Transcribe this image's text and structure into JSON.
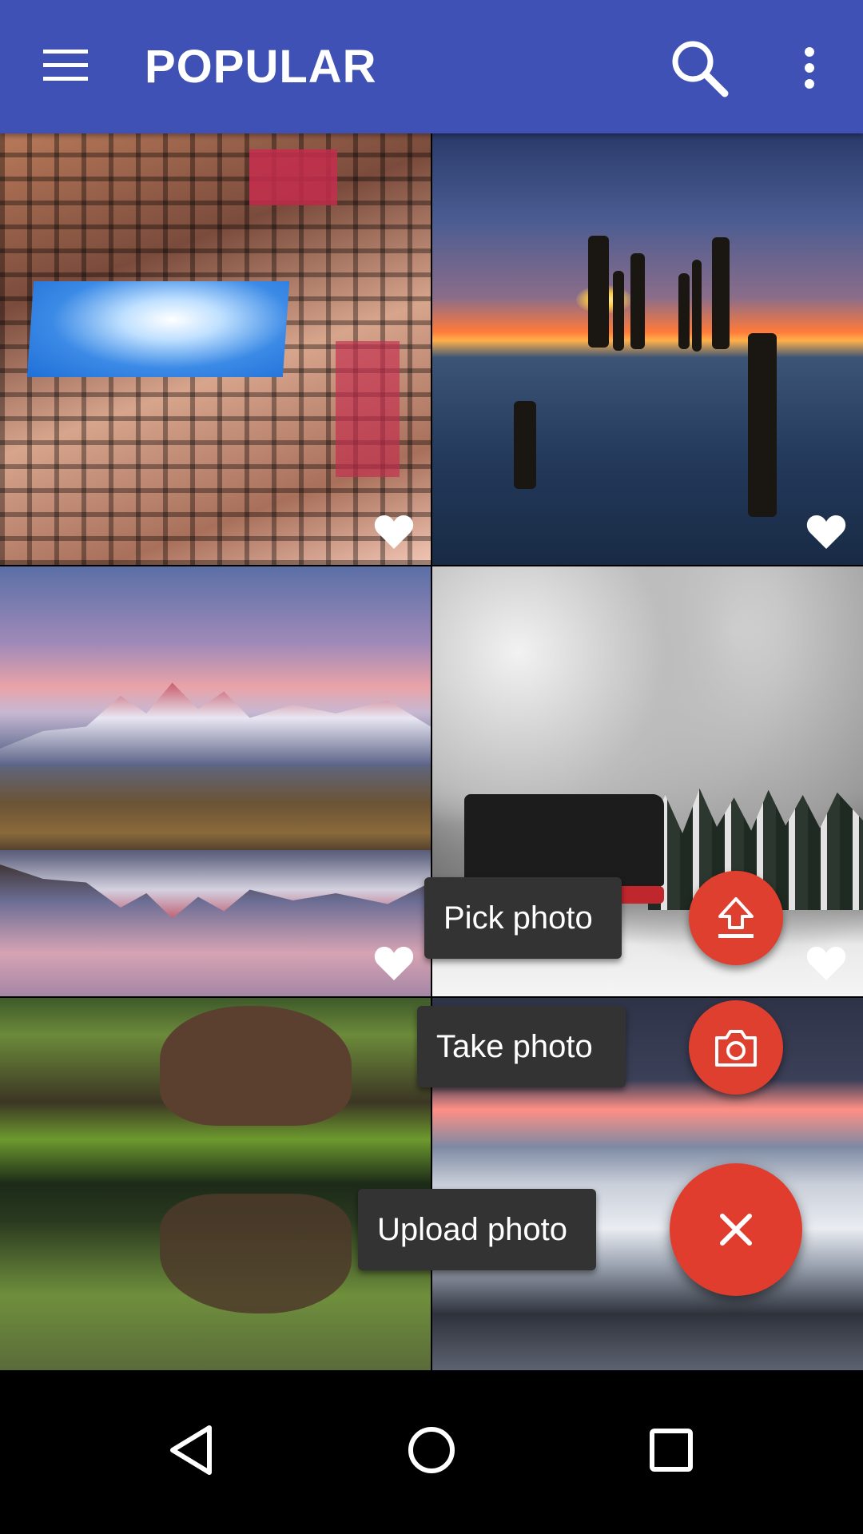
{
  "app_bar": {
    "title": "POPULAR",
    "color": "#3f51b5",
    "icons": [
      "menu-icon",
      "search-icon",
      "more-vert-icon"
    ]
  },
  "grid": {
    "photos": [
      {
        "subject": "high-rise apartment courtyard looking up",
        "favorite": true
      },
      {
        "subject": "wooden posts in sea at sunset",
        "favorite": true
      },
      {
        "subject": "mountain range reflected in lake",
        "favorite": true
      },
      {
        "subject": "steam train in snow",
        "favorite": true
      },
      {
        "subject": "brown bear reflected in water",
        "favorite": false
      },
      {
        "subject": "icy beach with waves",
        "favorite": false
      }
    ]
  },
  "speed_dial": {
    "actions": [
      {
        "label": "Pick photo",
        "icon": "upload-icon"
      },
      {
        "label": "Take photo",
        "icon": "camera-icon"
      }
    ],
    "main": {
      "label": "Upload photo",
      "icon": "close-icon"
    },
    "accent_color": "#e03d2e"
  },
  "nav_bar": {
    "icons": [
      "back-icon",
      "home-icon",
      "recents-icon"
    ]
  }
}
